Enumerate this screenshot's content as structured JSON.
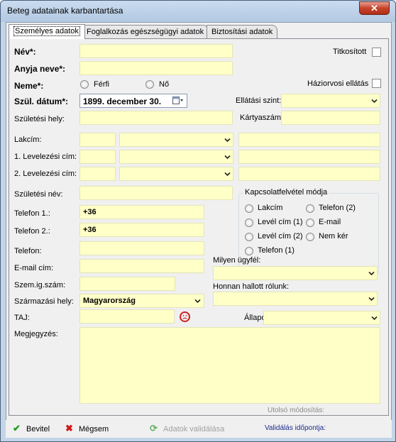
{
  "window": {
    "title": "Beteg adatainak karbantartása",
    "close_label": "✕"
  },
  "tabs": [
    {
      "label": "Személyes adatok"
    },
    {
      "label": "Foglalkozás egészségügyi adatok"
    },
    {
      "label": "Biztosítási adatok"
    }
  ],
  "form": {
    "nev_label": "Név*:",
    "anyja_neve_label": "Anyja neve*:",
    "neme_label": "Neme*:",
    "ferfi_label": "Férfi",
    "no_label": "Nő",
    "szul_datum_label": "Szül. dátum*:",
    "szul_datum_value": "1899.  december  30.",
    "szuletesi_hely_label": "Születési hely:",
    "lakcim_label": "Lakcím:",
    "levelezesi1_label": "1. Levelezési cím:",
    "levelezesi2_label": "2. Levelezési cím:",
    "szuletesi_nev_label": "Születési név:",
    "telefon1_label": "Telefon 1.:",
    "telefon1_value": "+36",
    "telefon2_label": "Telefon 2.:",
    "telefon2_value": "+36",
    "telefon_label": "Telefon:",
    "email_label": "E-mail cím:",
    "szemig_label": "Szem.ig.szám:",
    "szarmazasi_label": "Származási hely:",
    "szarmazasi_value": "Magyarország",
    "taj_label": "TAJ:",
    "megjegyzes_label": "Megjegyzés:",
    "titkositott_label": "Titkosított",
    "haziorvosi_label": "Háziorvosi ellátás",
    "ellatasi_szint_label": "Ellátási szint:",
    "kartyaszam_label": "Kártyaszám:",
    "kapcsolat_title": "Kapcsolatfelvétel módja",
    "kapcsolat_options": [
      "Lakcím",
      "Telefon (2)",
      "Levél cím (1)",
      "E-mail",
      "Levél cím (2)",
      "Nem kér",
      "Telefon (1)"
    ],
    "milyen_ugyfel_label": "Milyen ügyfél:",
    "honnan_label": "Honnan hallott rólunk:",
    "allapot_label": "Állapot:",
    "utolso_modositas_label": "Utolsó módosítás:"
  },
  "bottom": {
    "bevitel": "Bevitel",
    "megsem": "Mégsem",
    "validalas": "Adatok validálása",
    "validalas_idopontja": "Validálás időpontja:"
  }
}
